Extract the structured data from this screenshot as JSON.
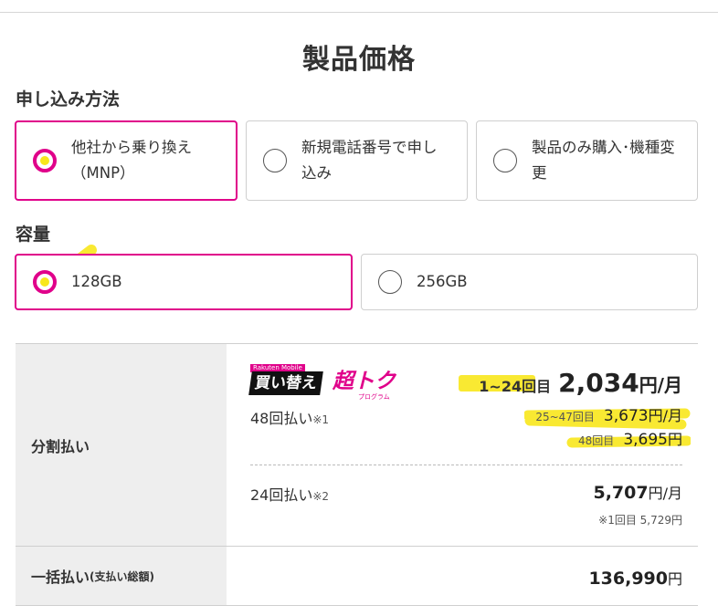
{
  "page_title": "製品価格",
  "application": {
    "label": "申し込み方法",
    "options": [
      {
        "line1": "他社から乗り換え",
        "line2": "（MNP）",
        "selected": true
      },
      {
        "line1": "新規電話番号で申し",
        "line2": "込み",
        "selected": false
      },
      {
        "line1": "製品のみ購入･機種変",
        "line2": "更",
        "selected": false
      }
    ]
  },
  "capacity": {
    "label": "容量",
    "options": [
      {
        "label": "128GB",
        "selected": true
      },
      {
        "label": "256GB",
        "selected": false
      }
    ]
  },
  "pricing": {
    "installment": {
      "label": "分割払い",
      "brand": {
        "top": "Rakuten Mobile",
        "black": "買い替え",
        "pink": "超トク",
        "sub": "プログラム"
      },
      "plan48": {
        "name": "48回払い",
        "note": "※1",
        "main_period": "1~24回目",
        "main_amount": "2,034",
        "main_unit": "円/月",
        "second_period": "25~47回目",
        "second_amount": "3,673",
        "second_unit": "円/月",
        "third_period": "48回目",
        "third_amount": "3,695",
        "third_unit": "円"
      },
      "plan24": {
        "name": "24回払い",
        "note": "※2",
        "amount": "5,707",
        "unit": "円/月",
        "first_note": "※1回目 5,729円"
      }
    },
    "lump_sum": {
      "label": "一括払い",
      "label_note": "(支払い総額)",
      "amount": "136,990",
      "unit": "円"
    }
  },
  "colors": {
    "accent": "#e0008a",
    "highlight": "#f8e71c"
  }
}
